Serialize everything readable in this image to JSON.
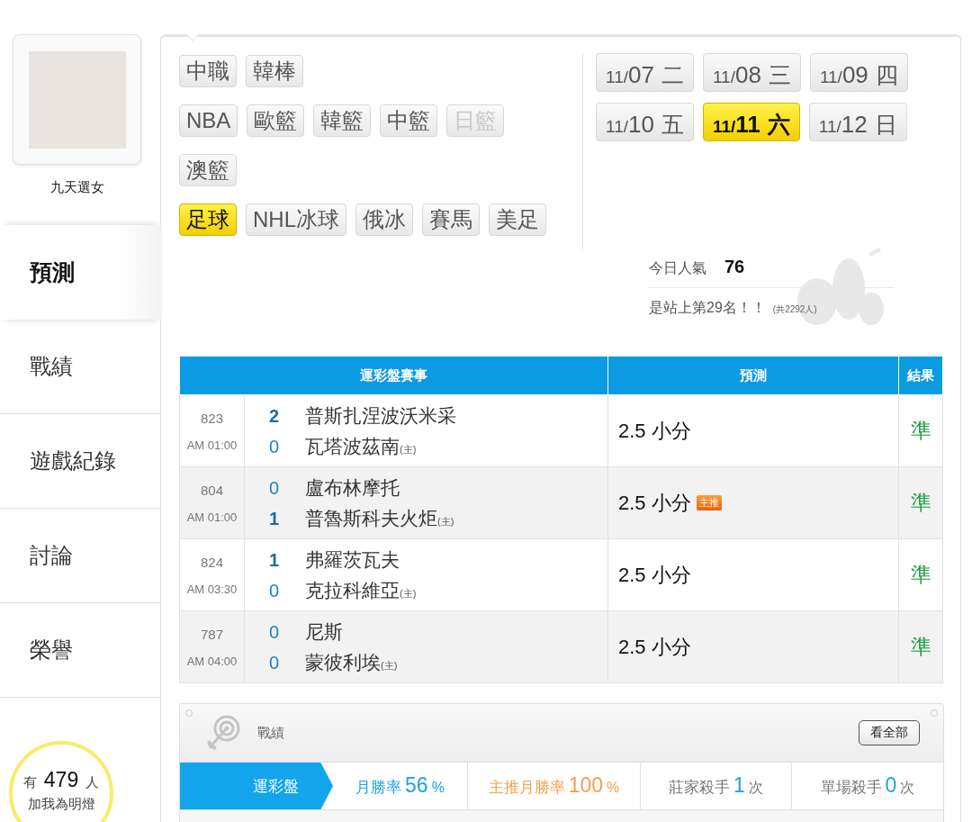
{
  "profile": {
    "name": "九天選女"
  },
  "nav": [
    {
      "label": "預測",
      "selected": true
    },
    {
      "label": "戰績",
      "selected": false
    },
    {
      "label": "遊戲紀錄",
      "selected": false
    },
    {
      "label": "討論",
      "selected": false
    },
    {
      "label": "榮譽",
      "selected": false
    }
  ],
  "fans": {
    "prefix": "有",
    "count": "479",
    "suffix": "人",
    "caption": "加我為明燈"
  },
  "category_rows": [
    [
      {
        "label": "中職",
        "selected": false,
        "disabled": false
      },
      {
        "label": "韓棒",
        "selected": false,
        "disabled": false
      }
    ],
    [
      {
        "label": "NBA",
        "selected": false,
        "disabled": false
      },
      {
        "label": "歐籃",
        "selected": false,
        "disabled": false
      },
      {
        "label": "韓籃",
        "selected": false,
        "disabled": false
      },
      {
        "label": "中籃",
        "selected": false,
        "disabled": false
      },
      {
        "label": "日籃",
        "selected": false,
        "disabled": true
      }
    ],
    [
      {
        "label": "澳籃",
        "selected": false,
        "disabled": false
      }
    ],
    [
      {
        "label": "足球",
        "selected": true,
        "disabled": false
      },
      {
        "label": "NHL冰球",
        "selected": false,
        "disabled": false
      },
      {
        "label": "俄冰",
        "selected": false,
        "disabled": false
      },
      {
        "label": "賽馬",
        "selected": false,
        "disabled": false
      },
      {
        "label": "美足",
        "selected": false,
        "disabled": false
      }
    ]
  ],
  "date_rows": [
    [
      {
        "month": "11/",
        "day": "07",
        "weekday": "二",
        "selected": false
      },
      {
        "month": "11/",
        "day": "08",
        "weekday": "三",
        "selected": false
      },
      {
        "month": "11/",
        "day": "09",
        "weekday": "四",
        "selected": false
      }
    ],
    [
      {
        "month": "11/",
        "day": "10",
        "weekday": "五",
        "selected": false
      },
      {
        "month": "11/",
        "day": "11",
        "weekday": "六",
        "selected": true
      },
      {
        "month": "11/",
        "day": "12",
        "weekday": "日",
        "selected": false
      }
    ]
  ],
  "popularity": {
    "label": "今日人氣",
    "value": "76",
    "rank": "是站上第29名！！",
    "total": "(共2292人)"
  },
  "table": {
    "columns": [
      "運彩盤賽事",
      "預測",
      "結果"
    ],
    "rows": [
      {
        "number": "823",
        "time": "AM 01:00",
        "teams": [
          {
            "score": "2",
            "leading": true,
            "name": "普斯扎涅波沃米采"
          },
          {
            "score": "0",
            "leading": false,
            "name": "瓦塔波茲南",
            "home_tag": "(主)"
          }
        ],
        "prediction": "2.5 小分",
        "badge": null,
        "result": "準"
      },
      {
        "number": "804",
        "time": "AM 01:00",
        "teams": [
          {
            "score": "0",
            "leading": false,
            "name": "盧布林摩托"
          },
          {
            "score": "1",
            "leading": true,
            "name": "普魯斯科夫火炬",
            "home_tag": "(主)"
          }
        ],
        "prediction": "2.5 小分",
        "badge": "主推",
        "result": "準"
      },
      {
        "number": "824",
        "time": "AM 03:30",
        "teams": [
          {
            "score": "1",
            "leading": true,
            "name": "弗羅茨瓦夫"
          },
          {
            "score": "0",
            "leading": false,
            "name": "克拉科維亞",
            "home_tag": "(主)"
          }
        ],
        "prediction": "2.5 小分",
        "badge": null,
        "result": "準"
      },
      {
        "number": "787",
        "time": "AM 04:00",
        "teams": [
          {
            "score": "0",
            "leading": false,
            "name": "尼斯"
          },
          {
            "score": "0",
            "leading": false,
            "name": "蒙彼利埃",
            "home_tag": "(主)"
          }
        ],
        "prediction": "2.5 小分",
        "badge": null,
        "result": "準"
      }
    ]
  },
  "record": {
    "title": "戰績",
    "button": "看全部",
    "tab": "運彩盤",
    "stats": [
      {
        "kind": "highlight",
        "label": "月勝率",
        "value": "56",
        "unit": "%",
        "color": "#1ea1e6"
      },
      {
        "kind": "highlight",
        "label": "主推月勝率",
        "value": "100",
        "unit": "%",
        "color": "#f5a04a"
      },
      {
        "kind": "count",
        "label": "莊家殺手",
        "value": "1",
        "unit": "次",
        "color": "#1ea1e6"
      },
      {
        "kind": "count",
        "label": "單場殺手",
        "value": "0",
        "unit": "次",
        "color": "#1ea1e6"
      }
    ]
  }
}
